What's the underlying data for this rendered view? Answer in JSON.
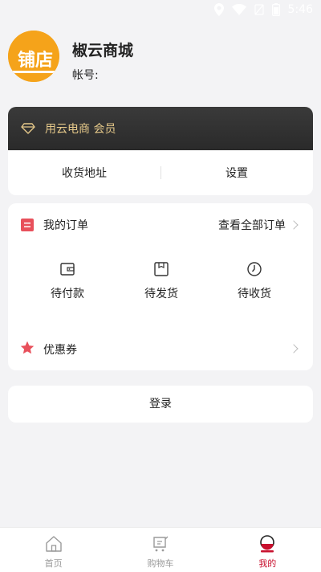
{
  "status_bar": {
    "time": "5:46"
  },
  "profile": {
    "logo_text": "铺店",
    "shop_name": "椒云商城",
    "account_label": "帐号:"
  },
  "member": {
    "title": "用云电商 会员",
    "links": [
      "收货地址",
      "设置"
    ]
  },
  "orders": {
    "title": "我的订单",
    "view_all": "查看全部订单",
    "statuses": [
      {
        "label": "待付款",
        "icon": "wallet-icon"
      },
      {
        "label": "待发货",
        "icon": "package-icon"
      },
      {
        "label": "待收货",
        "icon": "clock-icon"
      }
    ],
    "coupon": "优惠券"
  },
  "login": {
    "label": "登录"
  },
  "tabbar": {
    "tabs": [
      {
        "label": "首页",
        "icon": "home-icon",
        "active": false
      },
      {
        "label": "购物车",
        "icon": "cart-icon",
        "active": false
      },
      {
        "label": "我的",
        "icon": "profile-icon",
        "active": true
      }
    ]
  },
  "colors": {
    "accent_red": "#c8102e",
    "gold": "#e6c98a",
    "logo_orange": "#f5a31a",
    "star_red": "#e8505b"
  }
}
